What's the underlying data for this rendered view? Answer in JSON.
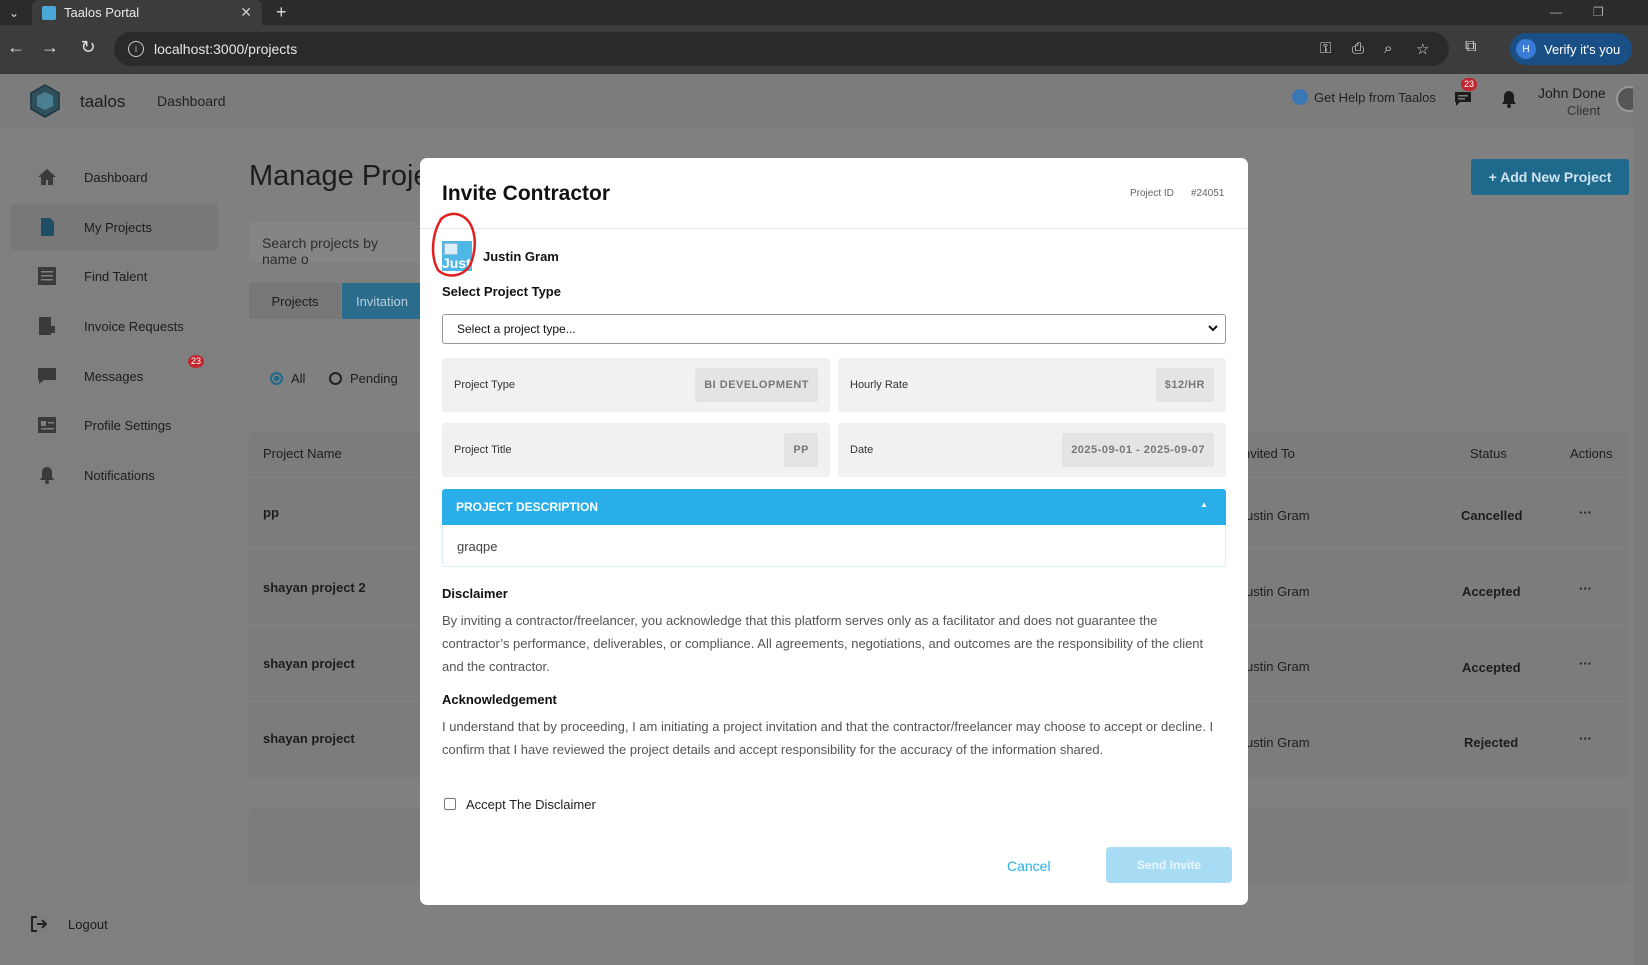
{
  "browser": {
    "tab_title": "Taalos Portal",
    "tab_close": "✕",
    "new_tab": "+",
    "url": "localhost:3000/projects",
    "verify_label": "Verify it's you",
    "verify_initial": "H"
  },
  "header": {
    "brand": "taalos",
    "nav_link": "Dashboard",
    "help_label": "Get Help from Taalos",
    "messages_badge": "23",
    "user_name": "John Done",
    "user_role": "Client"
  },
  "sidebar": {
    "items": [
      {
        "label": "Dashboard",
        "icon": "home-icon"
      },
      {
        "label": "My Projects",
        "icon": "document-icon"
      },
      {
        "label": "Find Talent",
        "icon": "list-icon"
      },
      {
        "label": "Invoice Requests",
        "icon": "invoice-icon"
      },
      {
        "label": "Messages",
        "icon": "chat-icon",
        "badge": "23"
      },
      {
        "label": "Profile Settings",
        "icon": "profile-card-icon"
      },
      {
        "label": "Notifications",
        "icon": "bell-icon"
      }
    ],
    "logout": "Logout"
  },
  "page": {
    "title": "Manage Proje",
    "add_button": "+ Add New Project",
    "search_placeholder": "Search projects by name o",
    "tabs": [
      "Projects",
      "Invitation"
    ],
    "filters": [
      "All",
      "Pending"
    ],
    "table": {
      "headers": {
        "name": "Project Name",
        "invited_to": "nvited To",
        "status": "Status",
        "actions": "Actions"
      },
      "rows": [
        {
          "name": "pp",
          "invited_to": "ustin Gram",
          "status": "Cancelled",
          "actions": "···"
        },
        {
          "name": "shayan project 2",
          "invited_to": "ustin Gram",
          "status": "Accepted",
          "actions": "···"
        },
        {
          "name": "shayan project",
          "invited_to": "ustin Gram",
          "status": "Accepted",
          "actions": "···"
        },
        {
          "name": "shayan project",
          "invited_to": "ustin Gram",
          "status": "Rejected",
          "actions": "···"
        }
      ]
    }
  },
  "modal": {
    "title": "Invite Contractor",
    "project_id_label": "Project ID",
    "project_id_value": "#24051",
    "contractor_name": "Justin Gram",
    "contractor_img_alt": "Just",
    "select_label": "Select Project Type",
    "select_value": "Select a project type...",
    "fields": {
      "project_type_label": "Project Type",
      "project_type_value": "BI DEVELOPMENT",
      "hourly_rate_label": "Hourly Rate",
      "hourly_rate_value": "$12/HR",
      "project_title_label": "Project Title",
      "project_title_value": "PP",
      "date_label": "Date",
      "date_value": "2025-09-01 - 2025-09-07"
    },
    "description_header": "PROJECT DESCRIPTION",
    "description_caret": "▲",
    "description_body": "graqpe",
    "disclaimer_title": "Disclaimer",
    "disclaimer_text": "By inviting a contractor/freelancer, you acknowledge that this platform serves only as a facilitator and does not guarantee the contractor’s performance, deliverables, or compliance. All agreements, negotiations, and outcomes are the responsibility of the client and the contractor.",
    "ack_title": "Acknowledgement",
    "ack_text": "I understand that by proceeding, I am initiating a project invitation and that the contractor/freelancer may choose to accept or decline. I confirm that I have reviewed the project details and accept responsibility for the accuracy of the information shared.",
    "checkbox_label": "Accept The Disclaimer",
    "cancel_label": "Cancel",
    "send_label": "Send Invite"
  },
  "colors": {
    "accent": "#29aee9",
    "highlight_ring": "#e02020",
    "badge": "#c0262d"
  }
}
